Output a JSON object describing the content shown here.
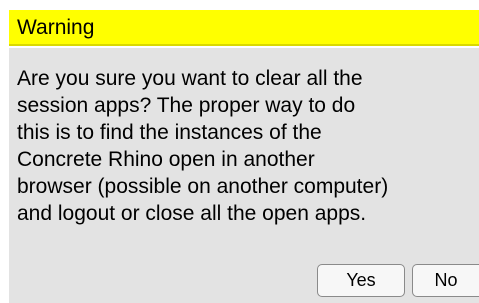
{
  "dialog": {
    "title": "Warning",
    "message": "Are you sure you want to clear all the\nsession apps? The proper way to do\nthis is to find the instances of the\nConcrete Rhino open in another\nbrowser (possible on another computer)\nand logout or close all the open apps.",
    "yes_label": "Yes",
    "no_label": "No"
  },
  "colors": {
    "titlebar_bg": "#ffff00",
    "body_bg": "#e3e3e3"
  }
}
